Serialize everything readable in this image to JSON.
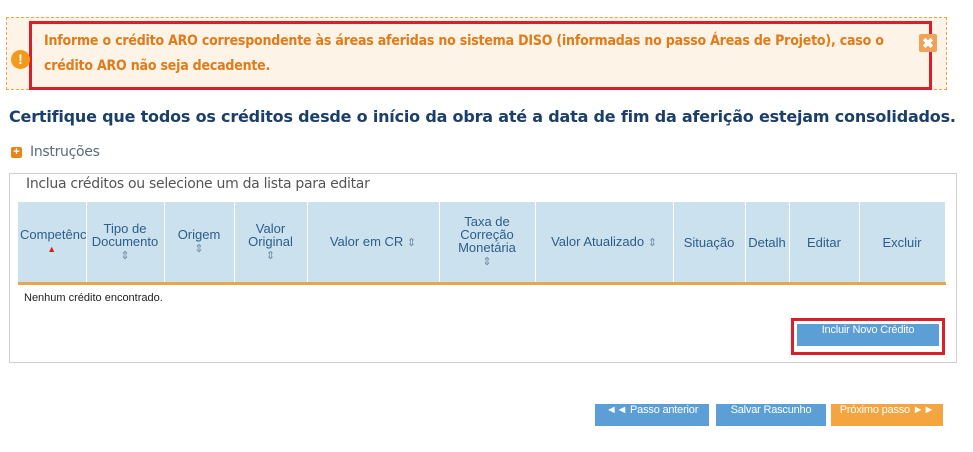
{
  "alert": {
    "message": "Informe o crédito ARO correspondente às áreas aferidas no sistema DISO (informadas no passo Áreas de Projeto), caso o crédito ARO não seja decadente.",
    "icon": "warning-icon",
    "close_icon": "close-icon",
    "color": "#e07b1a"
  },
  "heading": "Certifique que todos os créditos desde o início da obra até a data de fim da aferição estejam consolidados.",
  "instructions": {
    "label": "Instruções",
    "icon": "plus-icon"
  },
  "fieldset_legend": "Inclua créditos ou selecione um da lista para editar",
  "table": {
    "columns": [
      {
        "label": "Competênc",
        "sort": "▲"
      },
      {
        "label": "Tipo de Documento",
        "sort": "⇕"
      },
      {
        "label": "Origem",
        "sort": "⇕"
      },
      {
        "label": "Valor Original",
        "sort": "⇕"
      },
      {
        "label": "Valor em CR",
        "sort": "⇕"
      },
      {
        "label": "Taxa de Correção Monetária",
        "sort": "⇕"
      },
      {
        "label": "Valor Atualizado",
        "sort": "⇕"
      },
      {
        "label": "Situação",
        "sort": ""
      },
      {
        "label": "Detalh",
        "sort": ""
      },
      {
        "label": "Editar",
        "sort": ""
      },
      {
        "label": "Excluir",
        "sort": ""
      }
    ],
    "empty_message": "Nenhum crédito encontrado."
  },
  "buttons": {
    "add_credit": "Incluir Novo Crédito",
    "previous": "◄◄ Passo anterior",
    "save_draft": "Salvar Rascunho",
    "next": "Próximo passo ►►"
  },
  "colors": {
    "accent_blue": "#5b9fd6",
    "accent_orange": "#f5a540",
    "header_bg": "#cbe1ee",
    "highlight_red": "#d9202a"
  }
}
